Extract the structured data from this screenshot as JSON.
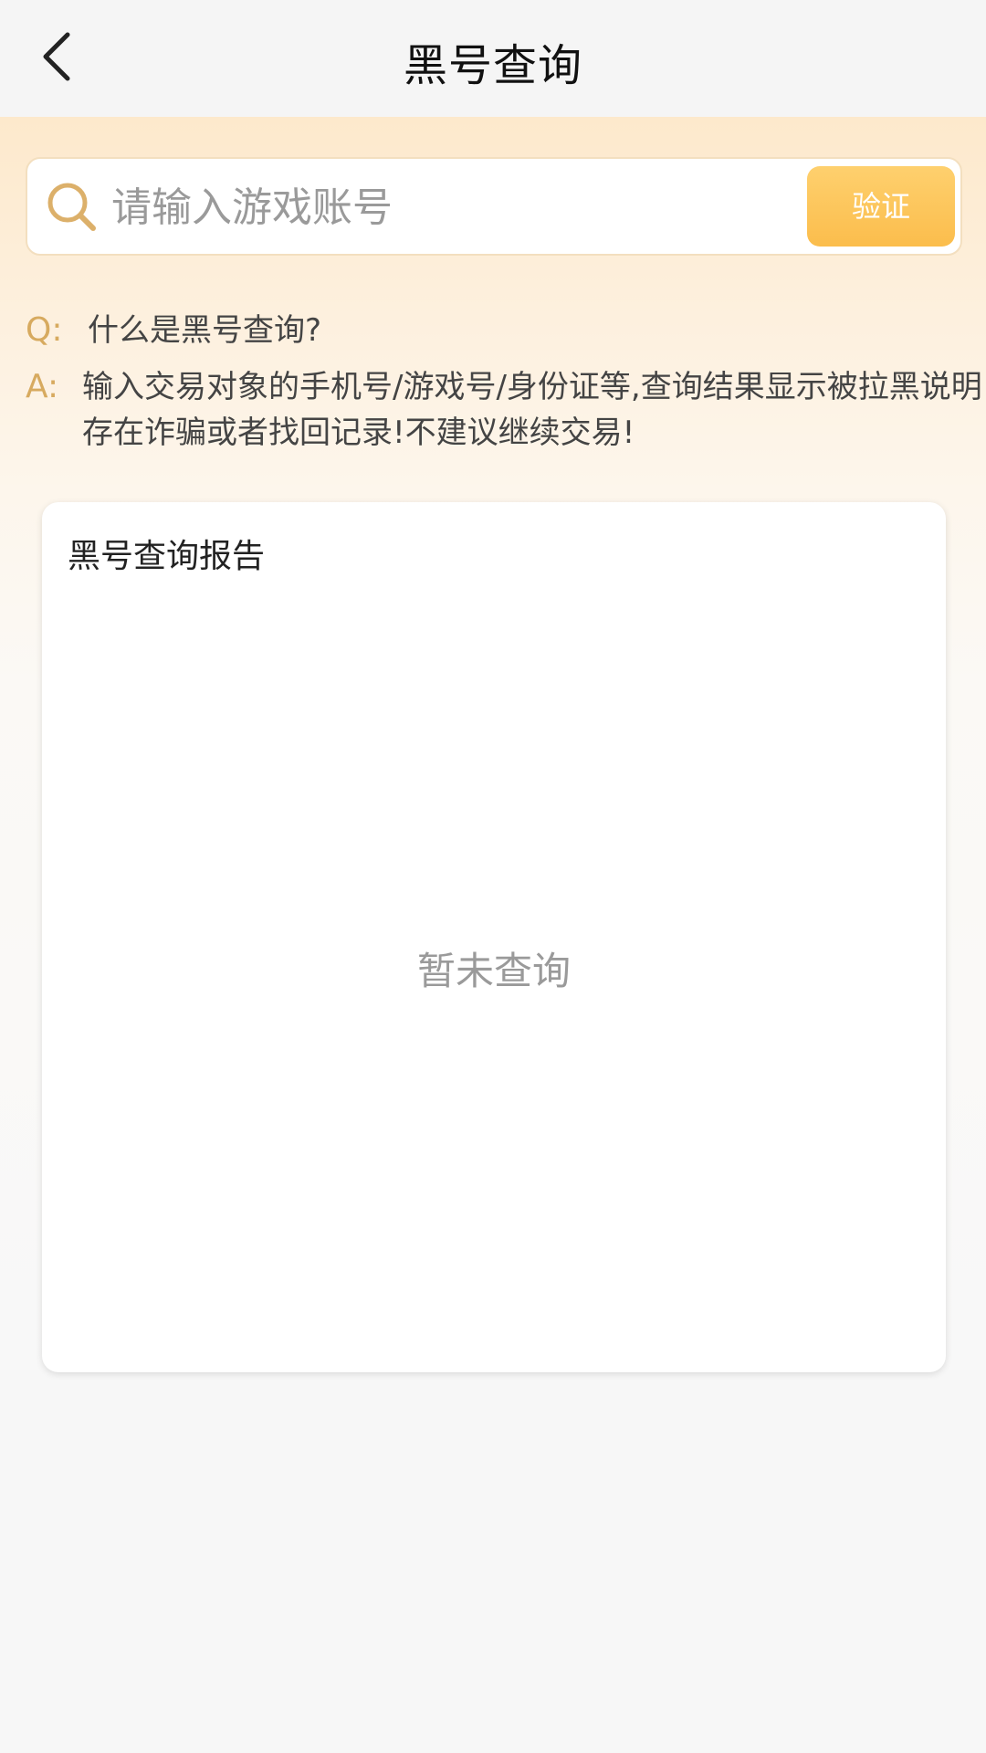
{
  "header": {
    "title": "黑号查询",
    "back_icon": "chevron-left-icon"
  },
  "search": {
    "placeholder": "请输入游戏账号",
    "value": "",
    "icon": "search-icon",
    "button_label": "验证"
  },
  "faq": {
    "q_prefix": "Q:",
    "question": "什么是黑号查询?",
    "a_prefix": "A:",
    "answer": "输入交易对象的手机号/游戏号/身份证等,查询结果显示被拉黑说明存在诈骗或者找回记录!不建议继续交易!"
  },
  "report": {
    "title": "黑号查询报告",
    "empty_text": "暂未查询"
  },
  "colors": {
    "accent": "#fbbd4c",
    "prefix": "#d7aa5f",
    "hero_top": "#fde9cc"
  }
}
